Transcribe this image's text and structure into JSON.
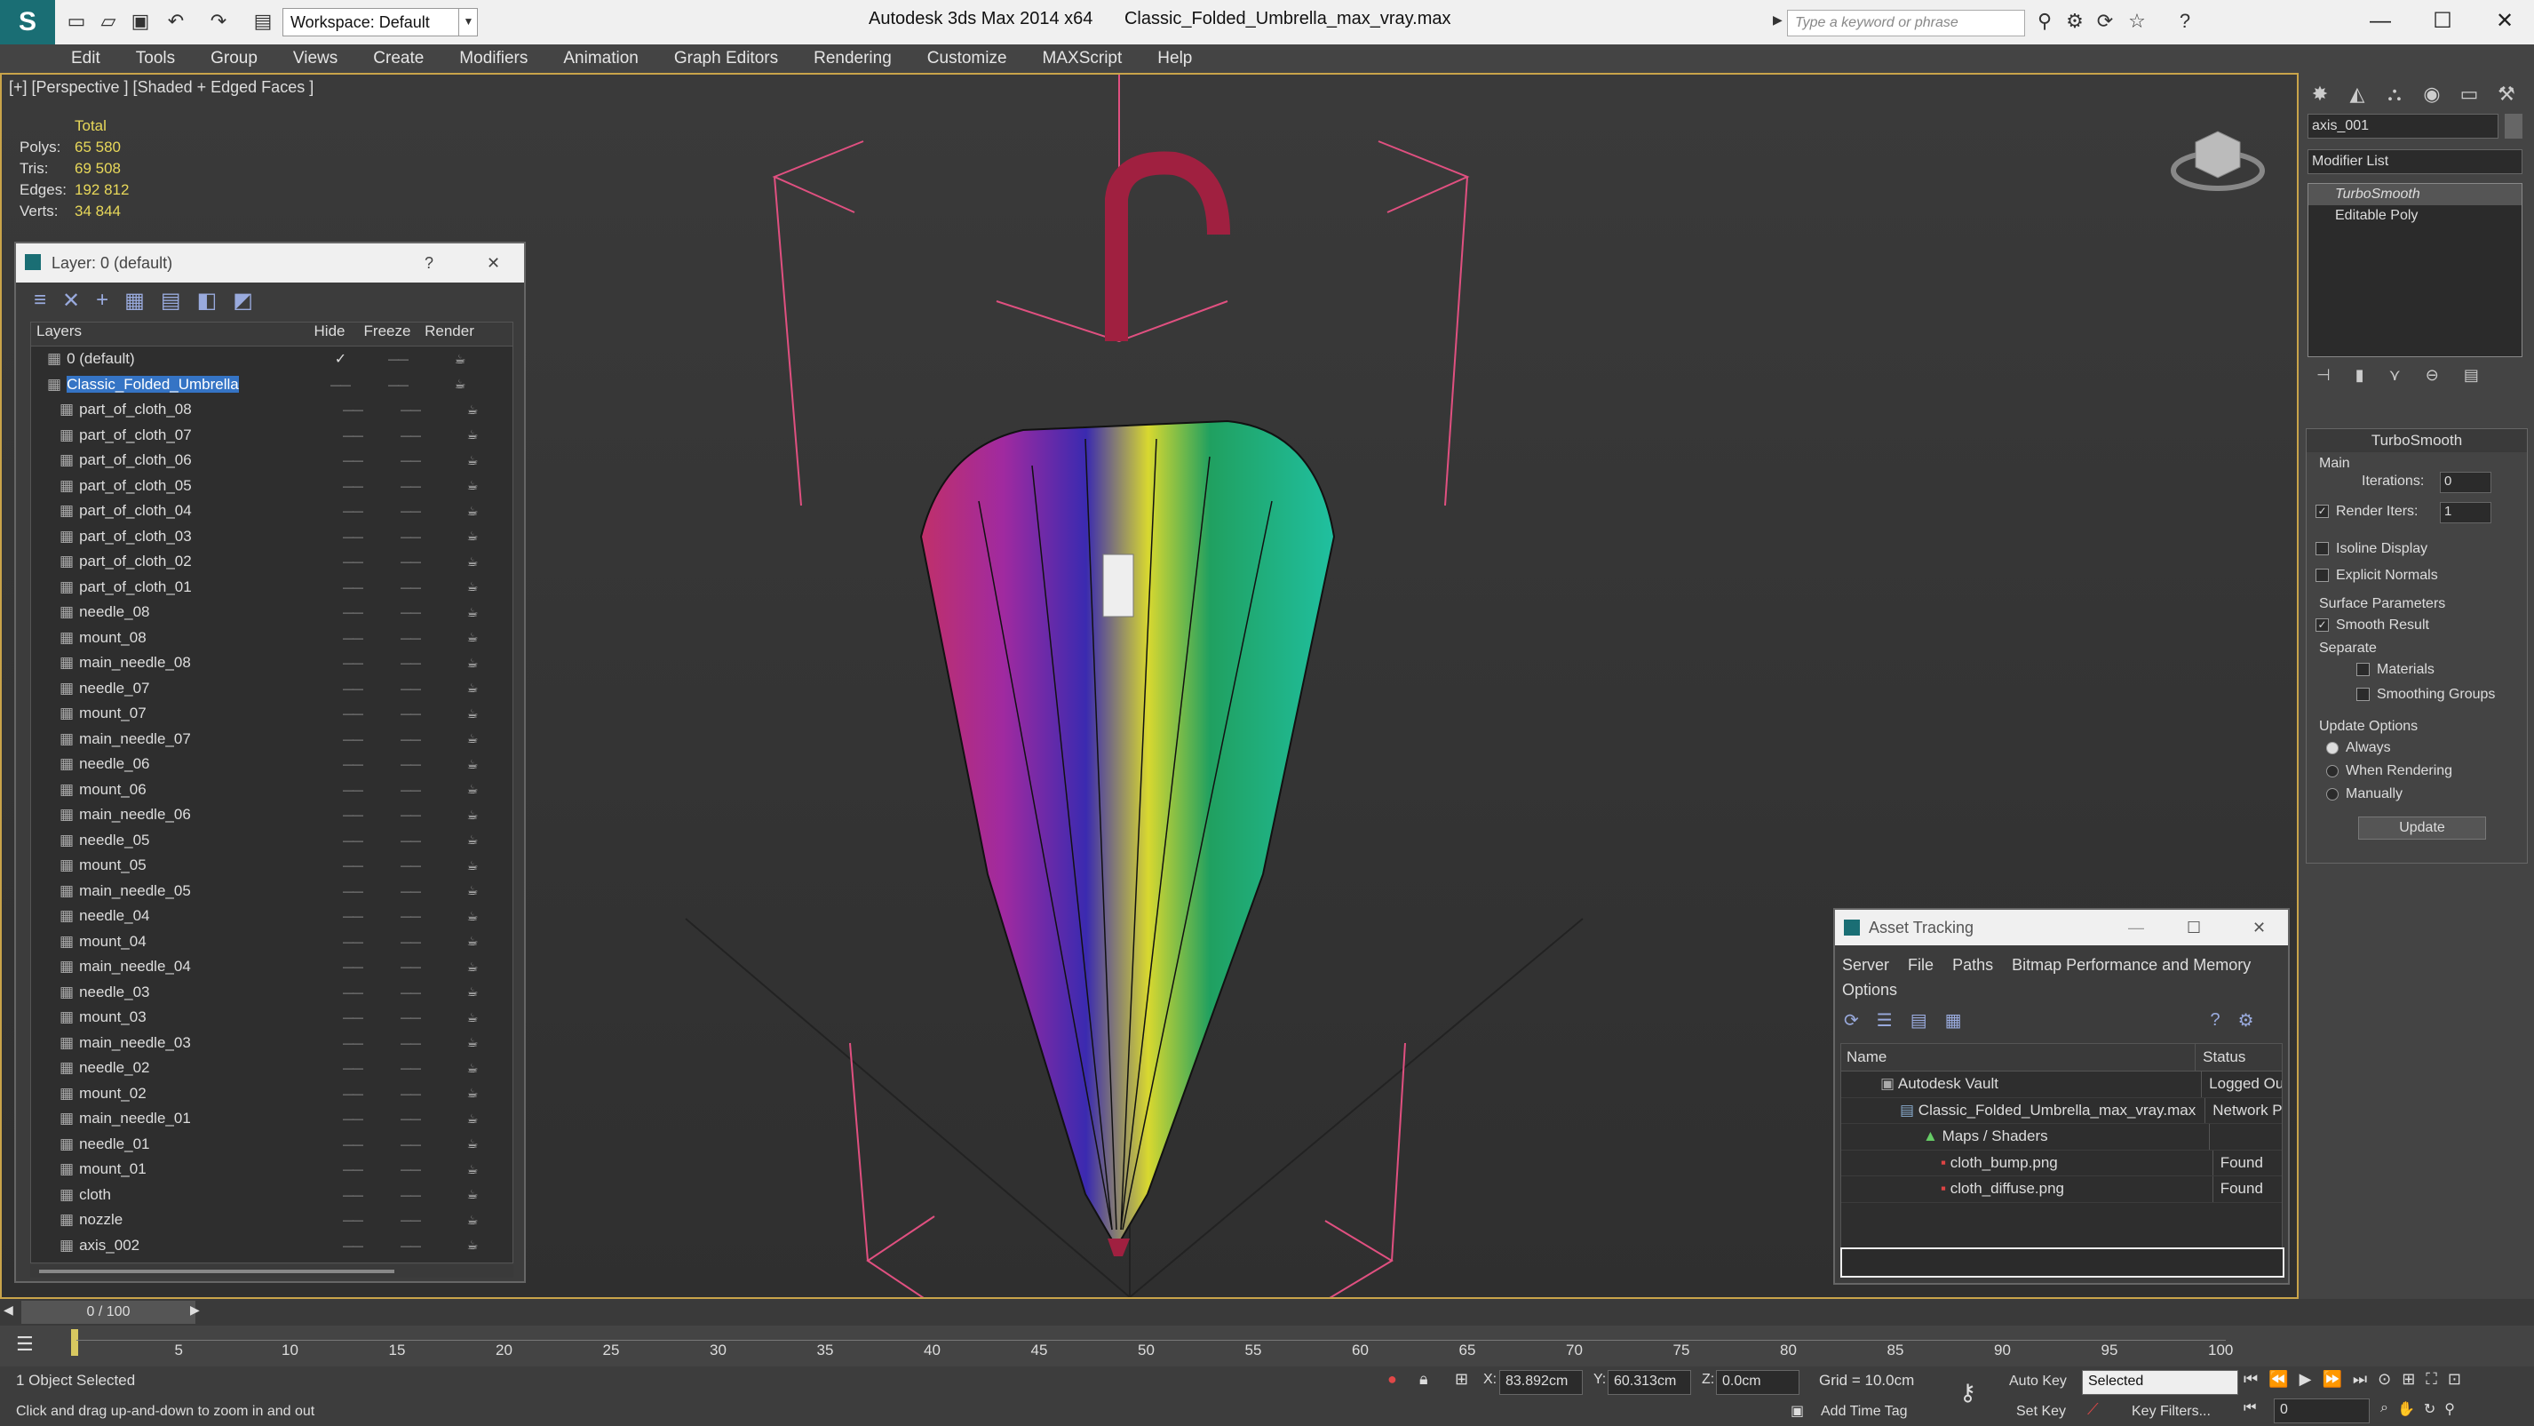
{
  "window": {
    "app_title": "Autodesk 3ds Max  2014 x64",
    "file_title": "Classic_Folded_Umbrella_max_vray.max",
    "workspace": "Workspace: Default",
    "search_placeholder": "Type a keyword or phrase",
    "minimize": "—",
    "maximize": "☐",
    "close": "✕"
  },
  "menu": [
    "Edit",
    "Tools",
    "Group",
    "Views",
    "Create",
    "Modifiers",
    "Animation",
    "Graph Editors",
    "Rendering",
    "Customize",
    "MAXScript",
    "Help"
  ],
  "viewport": {
    "label": "[+] [Perspective ] [Shaded + Edged Faces ]",
    "stats_header": "Total",
    "stats": [
      {
        "k": "Polys:",
        "v": "65 580"
      },
      {
        "k": "Tris:",
        "v": "69 508"
      },
      {
        "k": "Edges:",
        "v": "192 812"
      },
      {
        "k": "Verts:",
        "v": "34 844"
      }
    ]
  },
  "layer_dialog": {
    "title": "Layer: 0 (default)",
    "help": "?",
    "close": "✕",
    "columns": [
      "Layers",
      "Hide",
      "Freeze",
      "Render"
    ],
    "rows": [
      "0 (default)",
      "Classic_Folded_Umbrella",
      "part_of_cloth_08",
      "part_of_cloth_07",
      "part_of_cloth_06",
      "part_of_cloth_05",
      "part_of_cloth_04",
      "part_of_cloth_03",
      "part_of_cloth_02",
      "part_of_cloth_01",
      "needle_08",
      "mount_08",
      "main_needle_08",
      "needle_07",
      "mount_07",
      "main_needle_07",
      "needle_06",
      "mount_06",
      "main_needle_06",
      "needle_05",
      "mount_05",
      "main_needle_05",
      "needle_04",
      "mount_04",
      "main_needle_04",
      "needle_03",
      "mount_03",
      "main_needle_03",
      "needle_02",
      "mount_02",
      "main_needle_01",
      "needle_01",
      "mount_01",
      "cloth",
      "nozzle",
      "axis_002"
    ]
  },
  "command_panel": {
    "object_name": "axis_001",
    "modifier_list": "Modifier List",
    "stack": [
      "TurboSmooth",
      "Editable Poly"
    ],
    "rollout_title": "TurboSmooth",
    "main_label": "Main",
    "iterations_label": "Iterations:",
    "iterations_value": "0",
    "render_iters_label": "Render Iters:",
    "render_iters_value": "1",
    "isoline": "Isoline Display",
    "explicit": "Explicit Normals",
    "surface_params": "Surface Parameters",
    "smooth_result": "Smooth Result",
    "separate": "Separate",
    "materials": "Materials",
    "smoothing_groups": "Smoothing Groups",
    "update_options": "Update Options",
    "always": "Always",
    "when_rendering": "When Rendering",
    "manually": "Manually",
    "update_button": "Update"
  },
  "asset_tracking": {
    "title": "Asset Tracking",
    "menu": [
      "Server",
      "File",
      "Paths",
      "Bitmap Performance and Memory",
      "Options"
    ],
    "columns": [
      "Name",
      "Status"
    ],
    "rows": [
      {
        "name": "Autodesk Vault",
        "status": "Logged Ou"
      },
      {
        "name": "Classic_Folded_Umbrella_max_vray.max",
        "status": "Network P"
      },
      {
        "name": "Maps / Shaders",
        "status": ""
      },
      {
        "name": "cloth_bump.png",
        "status": "Found"
      },
      {
        "name": "cloth_diffuse.png",
        "status": "Found"
      }
    ]
  },
  "timeline": {
    "frame": "0 / 100",
    "ticks": [
      "5",
      "10",
      "15",
      "20",
      "25",
      "30",
      "35",
      "40",
      "45",
      "50",
      "55",
      "60",
      "65",
      "70",
      "75",
      "80",
      "85",
      "90",
      "95",
      "100"
    ]
  },
  "status": {
    "selection": "1 Object Selected",
    "prompt": "Click and drag up-and-down to zoom in and out",
    "x_label": "X:",
    "x_value": "83.892cm",
    "y_label": "Y:",
    "y_value": "60.313cm",
    "z_label": "Z:",
    "z_value": "0.0cm",
    "grid": "Grid = 10.0cm",
    "add_time_tag": "Add Time Tag",
    "auto_key": "Auto Key",
    "set_key": "Set Key",
    "selected": "Selected",
    "key_filters": "Key Filters...",
    "frame_value": "0"
  }
}
